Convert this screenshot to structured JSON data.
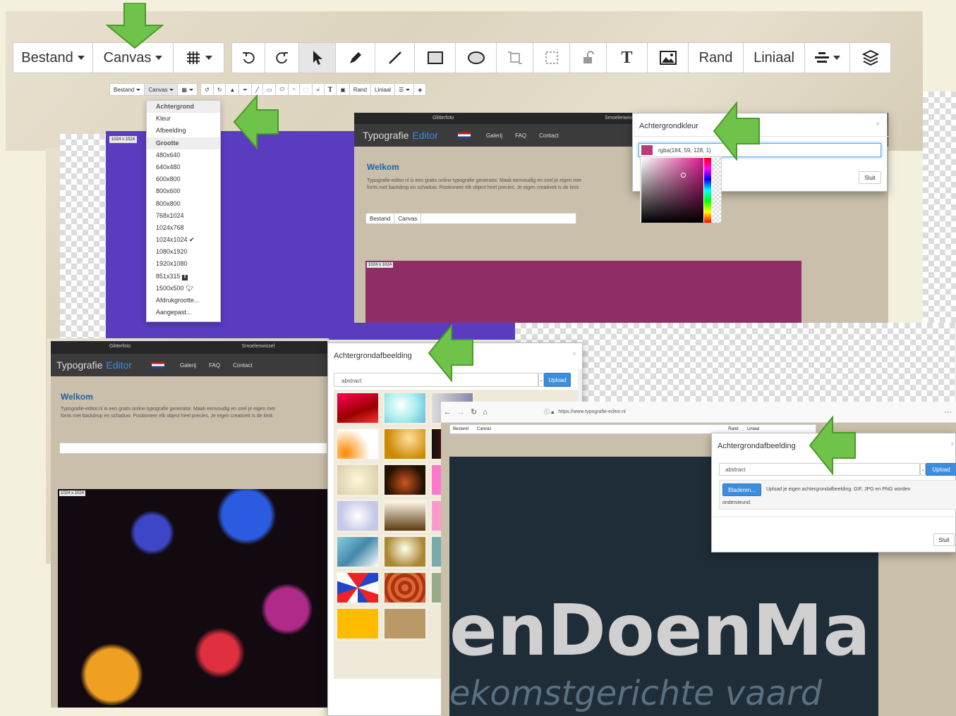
{
  "toolbar": {
    "bestand": "Bestand",
    "canvas": "Canvas",
    "rand": "Rand",
    "liniaal": "Liniaal",
    "icons": [
      "grid-icon",
      "undo-icon",
      "redo-icon",
      "pointer-icon",
      "pen-icon",
      "line-icon",
      "rectangle-icon",
      "ellipse-icon",
      "crop-icon",
      "resize-icon",
      "lock-icon",
      "text-icon",
      "image-icon",
      "align-icon",
      "layers-icon"
    ]
  },
  "canvas_menu": {
    "items": [
      "Achtergrond",
      "Kleur",
      "Afbeelding",
      "Grootte",
      "480x640",
      "640x480",
      "600x800",
      "800x600",
      "800x800",
      "768x1024",
      "1024x768",
      "1024x1024",
      "1080x1920",
      "1920x1080",
      "851x315",
      "1500x500",
      "Afdrukgrootte...",
      "Aangepast..."
    ],
    "checked": "1024x1024"
  },
  "canvas_size_label": "1024 x 1024",
  "site": {
    "tab1": "Glitterfoto",
    "tab2": "Smoelenwissel",
    "brand1": "Typografie",
    "brand2": "Editor",
    "nav": [
      "Galerij",
      "FAQ",
      "Contact"
    ],
    "welcome_title": "Welkom",
    "welcome_text_1": "Typografie-editor.nl is een gratis online typografie generator. Maak eenvoudig en snel je eigen mer",
    "welcome_text_1b": "Typografie-editor.nl is een gratis online typografie generator. Maak eenvoudig en snel je eigen mer",
    "welcome_text_2": "fonts met backdrop en schaduw. Positioneer elk object heel precies. Je eigen creativeit is de limit."
  },
  "color_modal": {
    "title": "Achtergrondkleur",
    "value": "rgba(184, 59, 128, 1)",
    "swatch": "#b83b80",
    "close_btn": "Sluit",
    "close_x": "×"
  },
  "image_modal": {
    "title": "Achtergrondafbeelding",
    "search": "abstract",
    "upload": "Upload",
    "close_x": "×"
  },
  "browser": {
    "url": "https://www.typografie-editor.nl",
    "more": "···"
  },
  "upload_modal": {
    "title": "Achtergrondafbeelding",
    "search": "abstract",
    "upload": "Upload",
    "browse": "Bladeren...",
    "help": "Upload je eigen achtergrondafbeelding. GIF, JPG en PNG worden",
    "help2": "ondersteund.",
    "close_btn": "Sluit",
    "close_x": "×"
  },
  "logo": {
    "line1": "enDoenMa",
    "line2": "ekomstgerichte vaard"
  },
  "colors": {
    "purple": "#5a3cc0",
    "magenta": "#8f2d66",
    "arrow": "#6fc24a",
    "dark_slate": "#1f2d38"
  }
}
